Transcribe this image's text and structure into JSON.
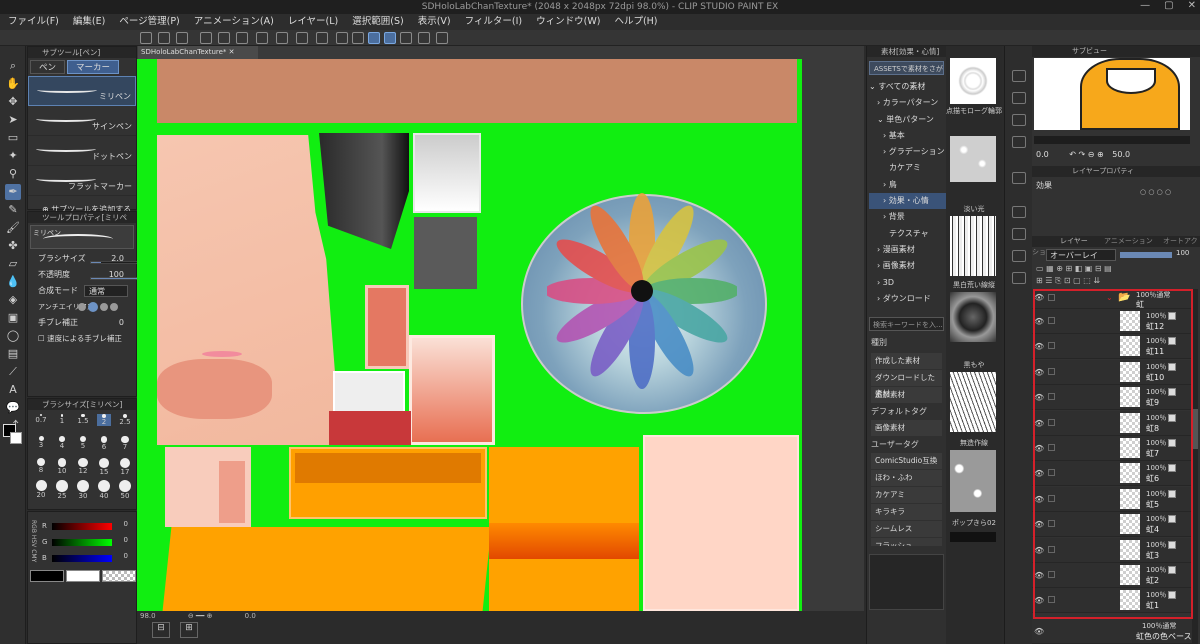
{
  "app": {
    "title": "SDHoloLabChanTexture* (2048 x 2048px 72dpi 98.0%) - CLIP STUDIO PAINT EX"
  },
  "menu": [
    "ファイル(F)",
    "編集(E)",
    "ページ管理(P)",
    "アニメーション(A)",
    "レイヤー(L)",
    "選択範囲(S)",
    "表示(V)",
    "フィルター(I)",
    "ウィンドウ(W)",
    "ヘルプ(H)"
  ],
  "subtool": {
    "header": "サブツール[ペン]",
    "tabs": [
      "ペン",
      "マーカー"
    ],
    "items": [
      "ミリペン",
      "サインペン",
      "ドットペン",
      "フラットマーカー"
    ],
    "add_label": "サブツールを追加する"
  },
  "toolprop": {
    "header": "ツールプロパティ[ミリペン]",
    "preset": "ミリペン",
    "brush_size_label": "ブラシサイズ",
    "brush_size_value": "2.0",
    "opacity_label": "不透明度",
    "opacity_value": "100",
    "blend_label": "合成モード",
    "blend_value": "通常",
    "aa_label": "アンチエイリアス",
    "stab_label": "手ブレ補正",
    "stab_value": "0",
    "speed_label": "速度による手ブレ補正"
  },
  "brushsize": {
    "header": "ブラシサイズ[ミリペン]",
    "values": [
      "0.7",
      "1",
      "1.5",
      "2",
      "2.5",
      "3",
      "4",
      "5",
      "6",
      "7",
      "8",
      "10",
      "12",
      "15",
      "17",
      "20",
      "25",
      "30",
      "40",
      "50"
    ]
  },
  "color": {
    "channels": [
      "R",
      "G",
      "B"
    ],
    "values": [
      "0",
      "0",
      "0"
    ],
    "modes": [
      "RGB",
      "HSV",
      "CMY"
    ],
    "main": "#000000",
    "sub": "#ffffff"
  },
  "canvas": {
    "tab": "SDHoloLabChanTexture*",
    "zoom": "98.0",
    "angle": "0.0",
    "bg": "#11ee11"
  },
  "assets": {
    "header": "素材[効果・心情]",
    "button": "ASSETSで素材をさがす",
    "tree": [
      "すべての素材",
      "カラーパターン",
      "単色パターン",
      "基本",
      "グラデーション",
      "カケアミ",
      "鳥",
      "効果・心情",
      "背景",
      "テクスチャ",
      "漫画素材",
      "画像素材",
      "3D",
      "ダウンロード"
    ],
    "selected_tree": "効果・心情",
    "search_placeholder": "検索キーワードを入...",
    "tag_header1": "種別",
    "tags1": [
      "作成した素材",
      "ダウンロードした素材",
      "追加素材"
    ],
    "tag_header2": "デフォルトタグ",
    "tags2": [
      "画像素材"
    ],
    "tag_header3": "ユーザータグ",
    "tags3": [
      "ComicStudio互換",
      "ほわ・ふわ",
      "カケアミ",
      "キラキラ",
      "シームレス",
      "フラッシュ"
    ],
    "thumbs": [
      "点描モローグ輪郭",
      "淡い光",
      "黒白荒い線縦",
      "黒もや",
      "無造作線",
      "ポップきら02"
    ]
  },
  "navigator": {
    "header": "サブビュー",
    "zoom": "50.0",
    "angle": "0.0"
  },
  "layerprop": {
    "header": "レイヤープロパティ",
    "effect_label": "効果"
  },
  "layers": {
    "tabs": [
      "レイヤー",
      "アニメーション",
      "オートアクション"
    ],
    "blend": "オーバーレイ",
    "opacity": "100",
    "folder": {
      "pct": "100％通常",
      "name": "虹"
    },
    "items": [
      {
        "pct": "100％",
        "name": "虹12"
      },
      {
        "pct": "100％",
        "name": "虹11"
      },
      {
        "pct": "100％",
        "name": "虹10"
      },
      {
        "pct": "100％",
        "name": "虹9"
      },
      {
        "pct": "100％",
        "name": "虹8"
      },
      {
        "pct": "100％",
        "name": "虹7"
      },
      {
        "pct": "100％",
        "name": "虹6"
      },
      {
        "pct": "100％",
        "name": "虹5"
      },
      {
        "pct": "100％",
        "name": "虹4"
      },
      {
        "pct": "100％",
        "name": "虹3"
      },
      {
        "pct": "100％",
        "name": "虹2"
      },
      {
        "pct": "100％",
        "name": "虹1"
      }
    ],
    "bottom": {
      "pct": "100％通常",
      "name": "虹色の色ベース"
    }
  }
}
